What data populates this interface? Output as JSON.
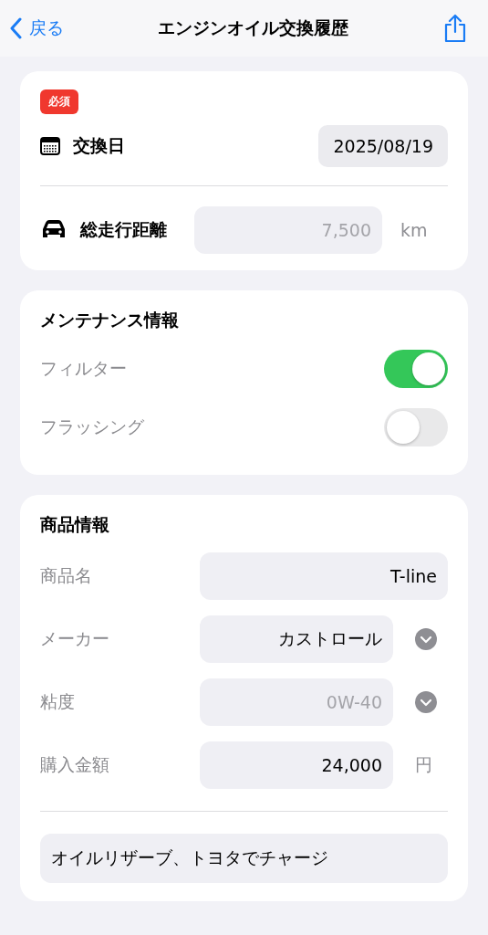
{
  "nav": {
    "back": "戻る",
    "title": "エンジンオイル交換履歴"
  },
  "required_section": {
    "badge": "必須",
    "date_label": "交換日",
    "date_value": "2025/08/19",
    "mileage_label": "総走行距離",
    "mileage_placeholder": "7,500",
    "mileage_unit": "km"
  },
  "maintenance": {
    "title": "メンテナンス情報",
    "toggles": [
      {
        "label": "フィルター",
        "on": true
      },
      {
        "label": "フラッシング",
        "on": false
      }
    ]
  },
  "product": {
    "title": "商品情報",
    "rows": [
      {
        "kind": "text",
        "label": "商品名",
        "value": "T-line"
      },
      {
        "kind": "picker",
        "label": "メーカー",
        "value": "カストロール"
      },
      {
        "kind": "picker",
        "label": "粘度",
        "placeholder": "0W-40"
      },
      {
        "kind": "unit",
        "label": "購入金額",
        "value": "24,000",
        "unit": "円"
      }
    ],
    "memo": "オイルリザーブ、トヨタでチャージ"
  }
}
